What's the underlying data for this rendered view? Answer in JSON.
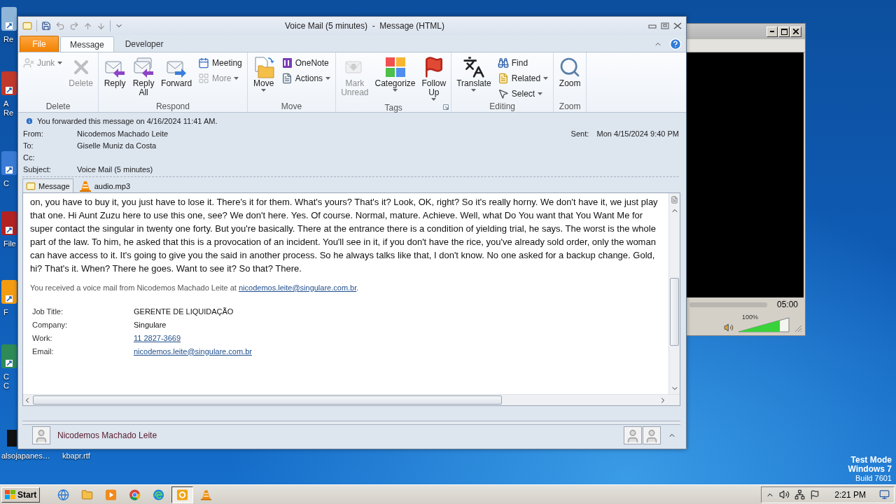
{
  "desktop": {
    "icons": [
      {
        "label": "Re"
      },
      {
        "label": "A Re"
      },
      {
        "label": "C"
      },
      {
        "label": "File"
      },
      {
        "label": "F"
      },
      {
        "label": "C C"
      }
    ],
    "bottom_icons": [
      {
        "label": "alsojapanes…"
      },
      {
        "label": "kbapr.rtf"
      }
    ],
    "system_info": [
      "Test Mode",
      "Windows 7",
      "Build 7601"
    ]
  },
  "media_player": {
    "time": "05:00",
    "volume_reading": "100%",
    "volume": {
      "level": 0.82
    }
  },
  "outlook": {
    "title": "Voice Mail (5 minutes)  -  Message (HTML)",
    "tabs": [
      {
        "label": "File",
        "kind": "file",
        "selected": false
      },
      {
        "label": "Message",
        "kind": "tab",
        "selected": true
      },
      {
        "label": "Developer",
        "kind": "tab",
        "selected": false
      }
    ],
    "ribbon": [
      {
        "label": "Delete",
        "launcher": false,
        "items": [
          {
            "kind": "small",
            "label": "Junk",
            "disabled": true,
            "dropdown": true
          },
          {
            "kind": "large",
            "label": "Delete",
            "disabled": true,
            "dropdown": false
          }
        ]
      },
      {
        "label": "Respond",
        "launcher": false,
        "items": [
          {
            "kind": "large",
            "label": "Reply",
            "disabled": false,
            "dropdown": false
          },
          {
            "kind": "large",
            "label": "Reply All",
            "disabled": false,
            "dropdown": false
          },
          {
            "kind": "large",
            "label": "Forward",
            "disabled": false,
            "dropdown": false
          },
          {
            "kind": "small",
            "label": "Meeting",
            "disabled": false,
            "dropdown": false
          },
          {
            "kind": "small",
            "label": "More",
            "disabled": true,
            "dropdown": true
          }
        ]
      },
      {
        "label": "Move",
        "launcher": false,
        "items": [
          {
            "kind": "large",
            "label": "Move",
            "disabled": false,
            "dropdown": true
          },
          {
            "kind": "small",
            "label": "OneNote",
            "disabled": false,
            "dropdown": false
          },
          {
            "kind": "small",
            "label": "Actions",
            "disabled": false,
            "dropdown": true
          }
        ]
      },
      {
        "label": "Tags",
        "launcher": true,
        "items": [
          {
            "kind": "large",
            "label": "Mark Unread",
            "disabled": true,
            "dropdown": false
          },
          {
            "kind": "large",
            "label": "Categorize",
            "disabled": false,
            "dropdown": true
          },
          {
            "kind": "large",
            "label": "Follow Up",
            "disabled": false,
            "dropdown": true
          }
        ]
      },
      {
        "label": "Editing",
        "launcher": false,
        "items": [
          {
            "kind": "large",
            "label": "Translate",
            "disabled": false,
            "dropdown": true
          },
          {
            "kind": "small",
            "label": "Find",
            "disabled": false,
            "dropdown": false
          },
          {
            "kind": "small",
            "label": "Related",
            "disabled": false,
            "dropdown": true
          },
          {
            "kind": "small",
            "label": "Select",
            "disabled": false,
            "dropdown": true
          }
        ]
      },
      {
        "label": "Zoom",
        "launcher": false,
        "items": [
          {
            "kind": "large",
            "label": "Zoom",
            "disabled": false,
            "dropdown": false
          }
        ]
      }
    ],
    "info_bar": "You forwarded this message on 4/16/2024 11:41 AM.",
    "fields": [
      {
        "label": "From:",
        "value": "Nicodemos Machado Leite"
      },
      {
        "label": "To:",
        "value": "Giselle Muniz da Costa"
      },
      {
        "label": "Cc:"
      },
      {
        "label": "Subject:",
        "value": "Voice Mail (5 minutes)"
      }
    ],
    "sent": {
      "label": "Sent:",
      "value": "Mon 4/15/2024 9:40 PM"
    },
    "attachments": [
      {
        "label": "Message",
        "selected": true
      },
      {
        "label": "audio.mp3",
        "selected": false
      }
    ],
    "body": {
      "paragraph": "on, you have to buy it, you just have to lose it. There's it for them. What's yours? That's it? Look, OK, right? So it's really horny. We don't have it, we just play that one. Hi Aunt Zuzu here to use this one, see? We don't here. Yes. Of course. Normal, mature. Achieve. Well, what Do You want that You Want Me for super contact the singular in twenty one forty. But you're basically. There at the entrance there is a condition of yielding trial, he says. The worst is the whole part of the law. To him, he asked that this is a provocation of an incident. You'll see in it, if you don't have the rice, you've already sold order, only the woman can have access to it. It's going to give you the said in another process. So he always talks like that, I don't know. No one asked for a backup change. Gold, hi? That's it. When? There he goes. Want to see it? So that? There.",
      "note": {
        "text": "You received a voice mail from Nicodemos Machado Leite at ",
        "link": "nicodemos.leite@singulare.com.br",
        "end": "."
      },
      "contact": [
        {
          "label": "Job Title:",
          "value": "GERENTE DE LIQUIDAÇÃO",
          "kind": "text"
        },
        {
          "label": "Company:",
          "value": "Singulare",
          "kind": "text"
        },
        {
          "label": "Work:",
          "value": "11 2827-3669",
          "kind": "link"
        },
        {
          "label": "Email:",
          "value": "nicodemos.leite@singulare.com.br",
          "kind": "link"
        }
      ]
    },
    "people_pane": {
      "name": "Nicodemos Machado Leite"
    }
  },
  "taskbar": {
    "start": "Start",
    "apps": [
      {
        "selected": false
      },
      {
        "selected": false
      },
      {
        "selected": false
      },
      {
        "selected": false
      },
      {
        "selected": false
      },
      {
        "selected": true
      },
      {
        "selected": false
      }
    ],
    "clock": "2:21 PM"
  }
}
